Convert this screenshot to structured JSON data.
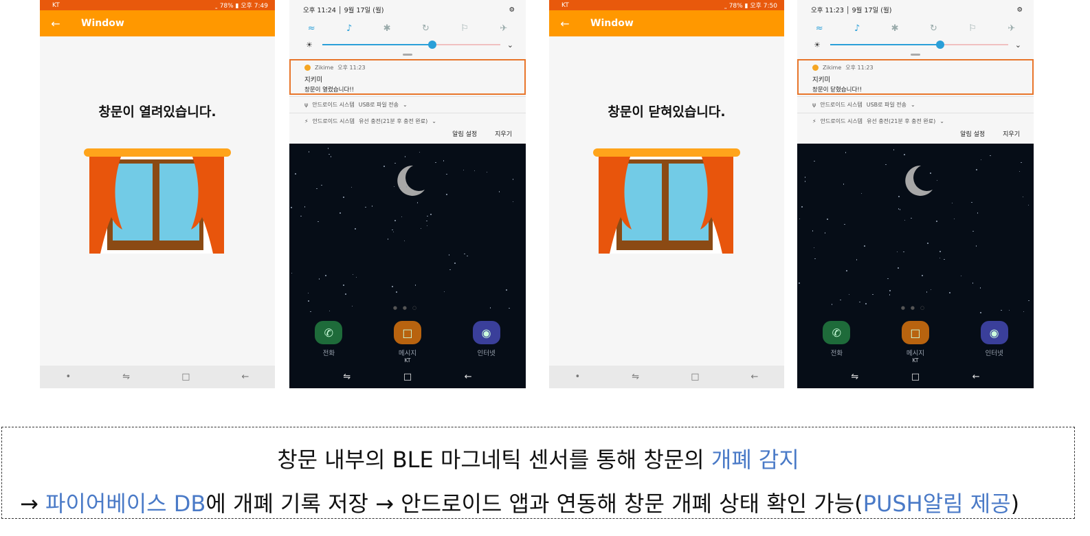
{
  "screen_open": {
    "status": {
      "carrier": "KT",
      "right": "͈ 78% ▮ 오후 7:49"
    },
    "appbar_title": "Window",
    "message": "창문이 열려있습니다."
  },
  "shade_open": {
    "time_row": "오후 11:24 │ 9월 17일 (월)",
    "notification": {
      "app": "Zikime",
      "time": "오후 11:23",
      "title": "지키미",
      "body": "창문이 열렸습니다!!"
    },
    "sys1": {
      "source": "안드로이드 시스템",
      "text": "USB로 파일 전송"
    },
    "sys2": {
      "source": "안드로이드 시스템",
      "text": "유선 충전(21분 후 충전 완료)"
    },
    "actions": {
      "settings": "알림 설정",
      "clear": "지우기"
    },
    "dock": [
      {
        "label": "전화"
      },
      {
        "label": "메시지",
        "sub": "KT"
      },
      {
        "label": "인터넷"
      }
    ]
  },
  "screen_closed": {
    "status": {
      "carrier": "KT",
      "right": "͈ 78% ▮ 오후 7:50"
    },
    "appbar_title": "Window",
    "message": "창문이 닫혀있습니다."
  },
  "shade_closed": {
    "time_row": "오후 11:23 │ 9월 17일 (월)",
    "notification": {
      "app": "Zikime",
      "time": "오후 11:23",
      "title": "지키미",
      "body": "창문이 닫혔습니다!!"
    },
    "sys1": {
      "source": "안드로이드 시스템",
      "text": "USB로 파일 전송"
    },
    "sys2": {
      "source": "안드로이드 시스템",
      "text": "유선 충전(21분 후 충전 완료)"
    },
    "actions": {
      "settings": "알림 설정",
      "clear": "지우기"
    },
    "dock": [
      {
        "label": "전화"
      },
      {
        "label": "메시지",
        "sub": "KT"
      },
      {
        "label": "인터넷"
      }
    ]
  },
  "brightness_level": 0.62,
  "caption": {
    "line1_prefix": "창문 내부의 BLE 마그네틱 센서를 통해 창문의 ",
    "line1_highlight": "개폐 감지",
    "line2_arrow": "→ ",
    "line2_highlight1": "파이어베이스 DB",
    "line2_mid": "에 개폐 기록 저장 →  안드로이드 앱과 연동해  창문 개폐 상태 확인 가능(",
    "line2_highlight2": "PUSH알림 제공",
    "line2_end": ")"
  },
  "colors": {
    "statusbar": "#e8590c",
    "appbar": "#ff9800",
    "curtain": "#e8550c",
    "glass": "#72cbe6",
    "frame": "#8b4a14",
    "highlight": "#4a7ac7",
    "notif_border": "#e8752a"
  }
}
